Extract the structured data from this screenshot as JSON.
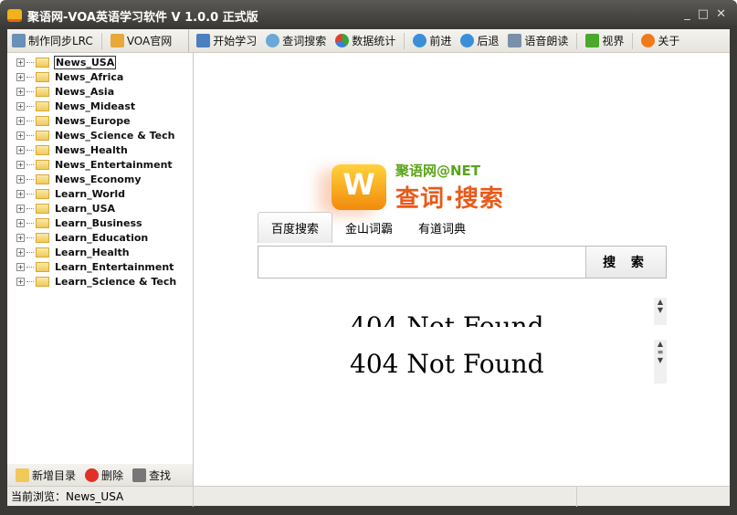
{
  "window": {
    "title": "聚语网-VOA英语学习软件 V 1.0.0 正式版",
    "controls": [
      "_",
      "□",
      "✕"
    ]
  },
  "toolbar": {
    "left": [
      {
        "label": "制作同步LRC",
        "icon": "lrc-icon"
      },
      {
        "label": "VOA官网",
        "icon": "home-icon"
      }
    ],
    "main": [
      {
        "label": "开始学习",
        "icon": "book-icon",
        "color": "#4a7fc0"
      },
      {
        "label": "查词搜索",
        "icon": "magnifier-icon",
        "color": "#6aa8d8"
      },
      {
        "label": "数据统计",
        "icon": "pie-chart-icon",
        "color": "#3ba53b"
      },
      {
        "label": "前进",
        "icon": "forward-icon",
        "color": "#3a8fd8"
      },
      {
        "label": "后退",
        "icon": "back-icon",
        "color": "#3a8fd8"
      },
      {
        "label": "语音朗读",
        "icon": "speaker-icon",
        "color": "#7a8fa8"
      },
      {
        "label": "视界",
        "icon": "view-icon",
        "color": "#4aa82a"
      },
      {
        "label": "关于",
        "icon": "info-icon",
        "color": "#f07a1a"
      }
    ]
  },
  "tree": {
    "items": [
      "News_USA",
      "News_Africa",
      "News_Asia",
      "News_Mideast",
      "News_Europe",
      "News_Science & Tech",
      "News_Health",
      "News_Entertainment",
      "News_Economy",
      "Learn_World",
      "Learn_USA",
      "Learn_Business",
      "Learn_Education",
      "Learn_Health",
      "Learn_Entertainment",
      "Learn_Science & Tech"
    ],
    "selected": "News_USA"
  },
  "tree_actions": [
    {
      "label": "新增目录",
      "icon": "add-folder-icon"
    },
    {
      "label": "删除",
      "icon": "delete-icon"
    },
    {
      "label": "查找",
      "icon": "binoculars-icon"
    }
  ],
  "status": {
    "text": "当前浏览：News_USA"
  },
  "search": {
    "brand_top": "聚语网@NET",
    "brand_main": "查词·搜索",
    "tabs": [
      "百度搜索",
      "金山词霸",
      "有道词典"
    ],
    "active_tab": "百度搜索",
    "input_value": "",
    "button": "搜 索"
  },
  "frames": [
    {
      "text": "404 Not Found"
    },
    {
      "text": "404 Not Found"
    }
  ]
}
